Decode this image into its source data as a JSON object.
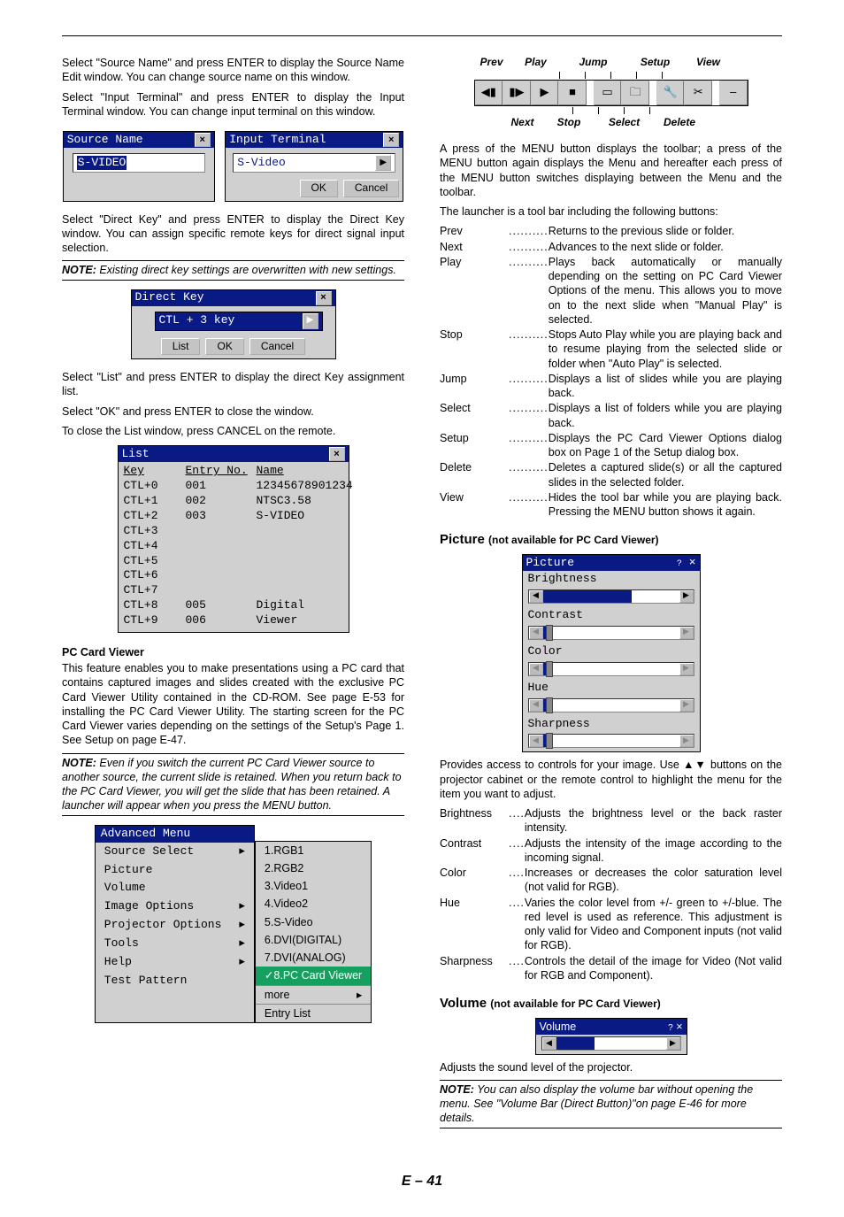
{
  "left": {
    "p1": "Select \"Source Name\" and press ENTER to display the Source Name Edit window. You can change source name on this window.",
    "p2": "Select \"Input Terminal\" and press ENTER to display the Input Terminal window. You can change input terminal on this window.",
    "sourceNameWin": {
      "title": "Source Name",
      "value": "S-VIDEO"
    },
    "inputTermWin": {
      "title": "Input Terminal",
      "value": "S-Video",
      "ok": "OK",
      "cancel": "Cancel"
    },
    "p3": "Select \"Direct Key\" and press ENTER to display the Direct Key window. You can assign specific remote keys for direct signal input selection.",
    "note1": "Existing direct key settings are overwritten with new settings.",
    "directKeyWin": {
      "title": "Direct Key",
      "value": "CTL + 3 key",
      "list": "List",
      "ok": "OK",
      "cancel": "Cancel"
    },
    "p4": "Select \"List\" and press ENTER to display the direct Key assignment list.",
    "p5": "Select \"OK\" and press ENTER to close the window.",
    "p6": "To close the List window, press CANCEL on the remote.",
    "listWin": {
      "title": "List",
      "hKey": "Key",
      "hEntry": "Entry No.",
      "hName": "Name",
      "rows": [
        {
          "k": "CTL+0",
          "e": "001",
          "n": "12345678901234"
        },
        {
          "k": "CTL+1",
          "e": "002",
          "n": "NTSC3.58"
        },
        {
          "k": "CTL+2",
          "e": "003",
          "n": "S-VIDEO"
        },
        {
          "k": "CTL+3",
          "e": "",
          "n": ""
        },
        {
          "k": "CTL+4",
          "e": "",
          "n": ""
        },
        {
          "k": "CTL+5",
          "e": "",
          "n": ""
        },
        {
          "k": "CTL+6",
          "e": "",
          "n": ""
        },
        {
          "k": "CTL+7",
          "e": "",
          "n": ""
        },
        {
          "k": "CTL+8",
          "e": "005",
          "n": "Digital"
        },
        {
          "k": "CTL+9",
          "e": "006",
          "n": "Viewer"
        }
      ]
    },
    "pcCardViewerTitle": "PC Card Viewer",
    "pcv1": "This feature enables you to make presentations using a PC card that contains captured images and slides created with the exclusive PC Card Viewer Utility contained in the CD-ROM. See page E-53 for installing the PC Card Viewer Utility. The starting screen for the PC Card Viewer varies depending on the settings of the Setup's Page 1. See Setup on page E-47.",
    "note2": "Even if you switch the current PC Card Viewer source to another source, the current slide is retained. When you return back to the PC Card Viewer, you will get the slide that has been retained. A launcher will appear when you press the MENU button.",
    "advMenu": {
      "title": "Advanced Menu",
      "items": [
        "Source Select",
        "Picture",
        "Volume",
        "Image Options",
        "Projector Options",
        "Tools",
        "Help",
        "Test Pattern"
      ],
      "arrows": [
        true,
        false,
        false,
        true,
        true,
        true,
        true,
        false
      ],
      "sub": [
        "1.RGB1",
        "2.RGB2",
        "3.Video1",
        "4.Video2",
        "5.S-Video",
        "6.DVI(DIGITAL)",
        "7.DVI(ANALOG)",
        "✓8.PC Card Viewer",
        "more",
        "Entry List"
      ],
      "subSel": 7,
      "moreArrow": true
    }
  },
  "right": {
    "toolbarLabelsTop": [
      "Prev",
      "Play",
      "Jump",
      "Setup",
      "View"
    ],
    "toolbarLabelsBot": [
      "Next",
      "Stop",
      "Select",
      "Delete"
    ],
    "p1": "A press of the MENU button displays the toolbar; a press of the MENU button again displays the Menu and hereafter each press of the MENU button switches displaying between the Menu and the toolbar.",
    "p2": "The launcher is a tool bar including the following buttons:",
    "launcher": [
      {
        "t": "Prev",
        "d": "Returns to the previous slide or folder."
      },
      {
        "t": "Next",
        "d": "Advances to the next slide or folder."
      },
      {
        "t": "Play",
        "d": "Plays back automatically or manually depending on the setting on PC Card Viewer Options of the menu. This allows you to move on to the next slide when \"Manual Play\" is selected."
      },
      {
        "t": "Stop",
        "d": "Stops Auto Play while you are playing back and to resume playing from the selected slide or folder when \"Auto Play\" is selected."
      },
      {
        "t": "Jump",
        "d": "Displays a list of slides while you are playing back."
      },
      {
        "t": "Select",
        "d": "Displays a list of folders while you are playing back."
      },
      {
        "t": "Setup",
        "d": "Displays the PC Card Viewer Options dialog box on Page 1 of the Setup dialog box."
      },
      {
        "t": "Delete",
        "d": "Deletes a captured slide(s) or all the captured slides in the selected folder."
      },
      {
        "t": "View",
        "d": "Hides the tool bar while you are playing back. Pressing the MENU button shows it again."
      }
    ],
    "picTitle": "Picture",
    "picSub": "(not available for PC Card Viewer)",
    "picWin": {
      "title": "Picture",
      "rows": [
        "Brightness",
        "Contrast",
        "Color",
        "Hue",
        "Sharpness"
      ]
    },
    "picDesc": "Provides access to controls for your image. Use ▲▼ buttons on the projector cabinet or the remote control to highlight the menu for the item you want to adjust.",
    "picList": [
      {
        "t": "Brightness",
        "d": "Adjusts the brightness level or the back raster intensity."
      },
      {
        "t": "Contrast",
        "d": "Adjusts the intensity of the image according to the incoming signal."
      },
      {
        "t": "Color",
        "d": "Increases or decreases the color saturation level (not valid for RGB)."
      },
      {
        "t": "Hue",
        "d": "Varies the color level from +/- green to +/-blue. The red level is used as reference. This adjustment is only valid for Video and Component inputs (not valid for RGB)."
      },
      {
        "t": "Sharpness",
        "d": "Controls the detail of the image for Video (Not valid for RGB and Component)."
      }
    ],
    "volTitle": "Volume",
    "volSub": "(not available for PC Card Viewer)",
    "volWinTitle": "Volume",
    "volDesc": "Adjusts the sound level of the projector.",
    "volNote": "You can also display the volume bar without opening the menu. See \"Volume Bar (Direct Button)\"on page E-46 for more details."
  },
  "noteLabel": "NOTE:",
  "pageNum": "E – 41"
}
